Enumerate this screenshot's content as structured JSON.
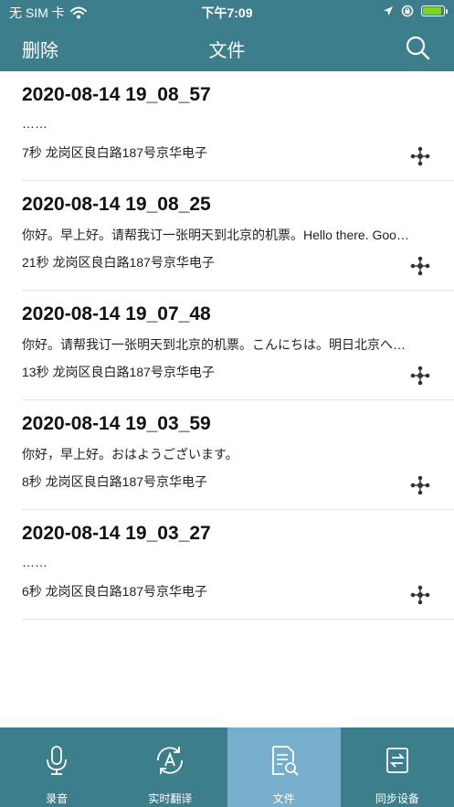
{
  "status": {
    "carrier": "无 SIM 卡",
    "time": "下午7:09"
  },
  "nav": {
    "left_label": "删除",
    "title": "文件"
  },
  "files": [
    {
      "title": "2020-08-14 19_08_57",
      "text": "……",
      "meta": "7秒 龙岗区良白路187号京华电子"
    },
    {
      "title": "2020-08-14 19_08_25",
      "text": "你好。早上好。请帮我订一张明天到北京的机票。Hello there. Goo…",
      "meta": "21秒 龙岗区良白路187号京华电子"
    },
    {
      "title": "2020-08-14 19_07_48",
      "text": "你好。请帮我订一张明天到北京的机票。こんにちは。明日北京へ…",
      "meta": "13秒 龙岗区良白路187号京华电子"
    },
    {
      "title": "2020-08-14 19_03_59",
      "text": "你好，早上好。おはようございます。",
      "meta": "8秒 龙岗区良白路187号京华电子"
    },
    {
      "title": "2020-08-14 19_03_27",
      "text": "……",
      "meta": "6秒 龙岗区良白路187号京华电子"
    }
  ],
  "tabs": [
    {
      "label": "录音",
      "icon": "microphone-icon",
      "active": false
    },
    {
      "label": "实时翻译",
      "icon": "translate-icon",
      "active": false
    },
    {
      "label": "文件",
      "icon": "file-search-icon",
      "active": true
    },
    {
      "label": "同步设备",
      "icon": "sync-device-icon",
      "active": false
    }
  ],
  "colors": {
    "header": "#3c7e8c",
    "active_tab": "#76aecb",
    "battery": "#7ed321"
  }
}
